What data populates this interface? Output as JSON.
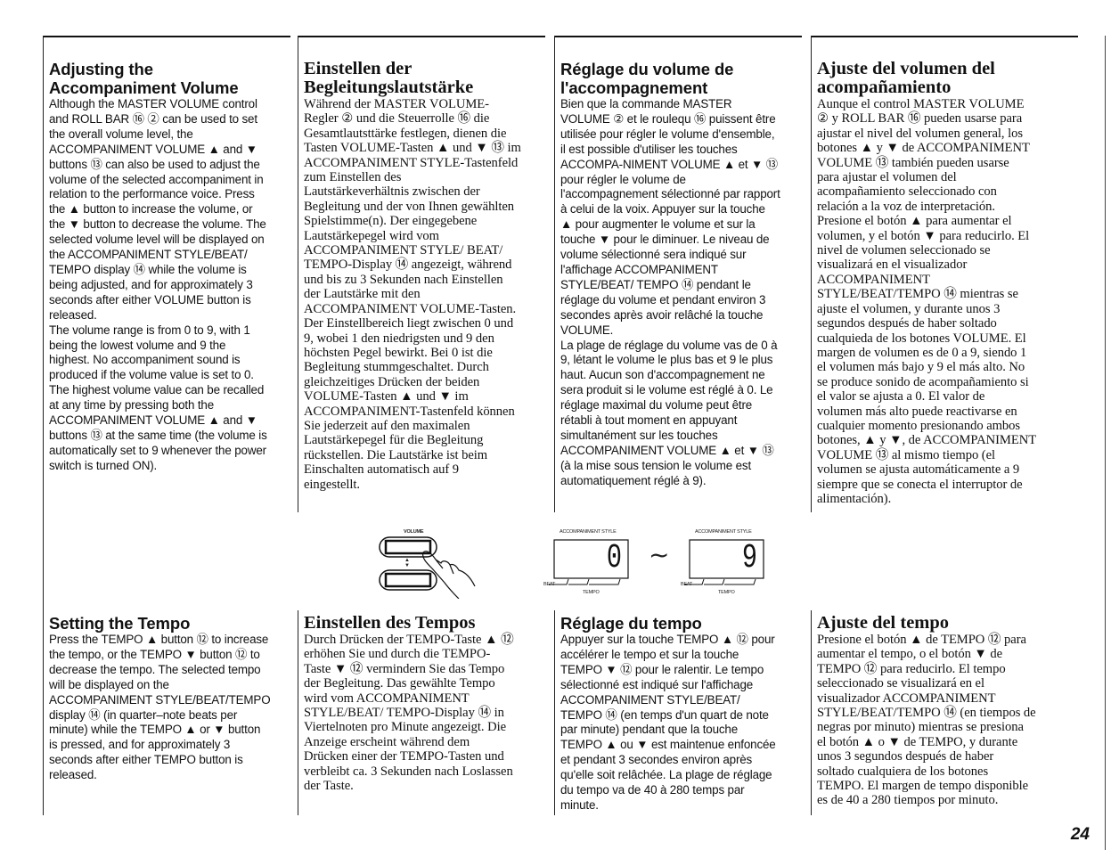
{
  "page_number": "24",
  "volume_sections": [
    {
      "lang": "en",
      "title": "Adjusting the\nAccompaniment Volume",
      "body": "Although the MASTER VOLUME control\nand ROLL BAR ⑯ ② can be used to set\nthe overall volume level, the\nACCOMPANIMENT VOLUME ▲ and ▼\nbuttons ⑬ can also be used to adjust the\nvolume of the selected accompaniment in\nrelation to the performance voice. Press\nthe ▲ button to increase the volume, or\nthe ▼ button to decrease the volume. The\nselected volume level will be displayed on\nthe ACCOMPANIMENT STYLE/BEAT/\nTEMPO display ⑭ while the volume is\nbeing adjusted, and for approximately 3\nseconds after either VOLUME button is\nreleased.\nThe volume range is from 0 to 9, with 1\nbeing the lowest volume and 9 the\nhighest. No accompaniment sound is\nproduced if the volume value is set to 0.\nThe highest volume value can be recalled\nat any time by pressing both the\nACCOMPANIMENT VOLUME ▲ and ▼\nbuttons ⑬ at the same time (the volume is\nautomatically set to 9 whenever the power\nswitch is turned ON)."
    },
    {
      "lang": "de",
      "title": "Einstellen der\nBegleitungslautstärke",
      "body": "Während der MASTER VOLUME-\nRegler ② und die Steuerrolle ⑯ die\nGesamtlautsttärke festlegen, dienen die\nTasten VOLUME-Tasten ▲ und ▼ ⑬ im\nACCOMPANIMENT STYLE-Tastenfeld\nzum Einstellen des\nLautstärkeverhältnis zwischen der\nBegleitung und der von Ihnen gewählten\nSpielstimme(n). Der eingegebene\nLautstärkepegel wird vom\nACCOMPANIMENT STYLE/ BEAT/\nTEMPO-Display ⑭ angezeigt, während\nund bis zu 3 Sekunden nach Einstellen\nder Lautstärke mit den\nACCOMPANIMENT VOLUME-Tasten.\nDer Einstellbereich liegt zwischen 0 und\n9, wobei 1 den niedrigsten und 9 den\nhöchsten Pegel bewirkt. Bei 0 ist die\nBegleitung stummgeschaltet. Durch\ngleichzeitiges Drücken der beiden\nVOLUME-Tasten ▲ und ▼ im\nACCOMPANIMENT-Tastenfeld können\nSie jederzeit auf den maximalen\nLautstärkepegel für die Begleitung\nrückstellen. Die Lautstärke ist beim\nEinschalten automatisch auf 9\neingestellt."
    },
    {
      "lang": "fr",
      "title": "Réglage du volume de\nl'accompagnement",
      "body": "Bien que la commande MASTER\nVOLUME ② et le roulequ ⑯ puissent être\nutilisée pour régler le volume d'ensemble,\nil est possible d'utiliser les touches\nACCOMPA-NIMENT VOLUME ▲ et ▼ ⑬\npour régler le volume de\nl'accompagnement sélectionné par rapport\nà celui de la voix.  Appuyer sur la touche\n▲ pour augmenter le volume et sur la\ntouche ▼ pour le diminuer. Le niveau de\nvolume sélectionné sera indiqué sur\nl'affichage ACCOMPANIMENT\nSTYLE/BEAT/ TEMPO ⑭ pendant le\nréglage du volume et pendant environ 3\nsecondes après avoir relâché la touche\nVOLUME.\nLa plage de réglage du volume vas de 0 à\n9, létant le volume le plus bas et 9 le plus\nhaut. Aucun son d'accompagnement ne\nsera produit si le volume est réglé à 0. Le\nréglage maximal du volume peut être\nrétabli à tout moment en appuyant\nsimultanément sur les touches\nACCOMPANIMENT VOLUME ▲ et ▼ ⑬\n(à la mise sous tension le volume est\nautomatiquement réglé à 9)."
    },
    {
      "lang": "es",
      "title": "Ajuste del volumen del\nacompañamiento",
      "body": "Aunque el control MASTER VOLUME\n② y ROLL BAR ⑯ pueden usarse para\najustar el nivel del volumen general, los\nbotones ▲ y ▼ de ACCOMPANIMENT\nVOLUME ⑬ también pueden usarse\npara ajustar el volumen del\nacompañamiento seleccionado con\nrelación a la voz de interpretación.\nPresione el botón ▲ para aumentar el\nvolumen, y el botón ▼ para reducirlo.  El\nnivel de volumen seleccionado se\nvisualizará en el visualizador\nACCOMPANIMENT\nSTYLE/BEAT/TEMPO ⑭ mientras se\najuste el volumen, y durante unos 3\nsegundos después de haber soltado\ncualquieda de los botones VOLUME. El\nmargen de volumen es de 0 a 9, siendo 1\nel volumen más bajo y 9 el más alto.  No\nse produce sonido de acompañamiento si\nel valor se ajusta a 0.  El valor de\nvolumen más alto puede reactivarse en\ncualquier momento presionando ambos\nbotones, ▲ y ▼,  de ACCOMPANIMENT\nVOLUME ⑬ al mismo tiempo (el\nvolumen se ajusta automáticamente a 9\nsiempre que se conecta el interruptor de\nalimentación)."
    }
  ],
  "illustration": {
    "volume_panel_label": "VOLUME",
    "updown_glyph": "▲▼",
    "display_label": "ACCOMPANIMENT STYLE",
    "beat_label": "BEAT",
    "tempo_label": "TEMPO",
    "range_separator": "~",
    "display_min_value": "0",
    "display_max_value": "9"
  },
  "tempo_sections": [
    {
      "lang": "en",
      "title": "Setting the Tempo",
      "body": "Press the TEMPO ▲ button ⑫ to increase\nthe tempo, or the TEMPO ▼ button ⑫ to\ndecrease the tempo. The selected tempo\nwill be displayed on the\nACCOMPANIMENT STYLE/BEAT/TEMPO\ndisplay ⑭ (in quarter–note beats per\nminute) while the TEMPO ▲ or ▼ button\nis pressed, and for approximately 3\nseconds after either TEMPO button is\nreleased."
    },
    {
      "lang": "de",
      "title": "Einstellen des Tempos",
      "body": " Durch Drücken der TEMPO-Taste ▲ ⑫\nerhöhen Sie und durch die TEMPO-\nTaste ▼ ⑫ vermindern Sie das Tempo\nder Begleitung. Das gewählte Tempo\nwird vom ACCOMPANIMENT\nSTYLE/BEAT/ TEMPO-Display ⑭ in\nViertelnoten pro Minute angezeigt. Die\nAnzeige erscheint während dem\nDrücken einer der TEMPO-Tasten und\nverbleibt ca. 3 Sekunden nach Loslassen\nder Taste."
    },
    {
      "lang": "fr",
      "title": "Réglage du tempo",
      "body": "Appuyer sur la touche TEMPO ▲ ⑫ pour\naccélérer le tempo et sur la touche\nTEMPO ▼ ⑫ pour le ralentir. Le tempo\nsélectionné est indiqué sur l'affichage\nACCOMPANIMENT STYLE/BEAT/\nTEMPO ⑭ (en temps d'un quart de note\npar minute) pendant que la touche\nTEMPO ▲ ou ▼ est maintenue enfoncée\net pendant 3 secondes environ après\nqu'elle soit relâchée. La plage de réglage\ndu tempo va de 40 à 280 temps par\nminute."
    },
    {
      "lang": "es",
      "title": "Ajuste del tempo",
      "body": "Presione el botón ▲ de TEMPO ⑫ para\naumentar el tempo, o el botón ▼ de\nTEMPO ⑫ para reducirlo.  El tempo\nseleccionado se visualizará en el\nvisualizador ACCOMPANIMENT\nSTYLE/BEAT/TEMPO ⑭ (en tiempos de\nnegras por minuto) mientras se presiona\nel botón ▲ o ▼ de TEMPO, y durante\nunos 3 segundos después de haber\nsoltado cualquiera de los botones\nTEMPO. El margen de tempo disponible\nes de 40 a 280 tiempos por minuto."
    }
  ]
}
